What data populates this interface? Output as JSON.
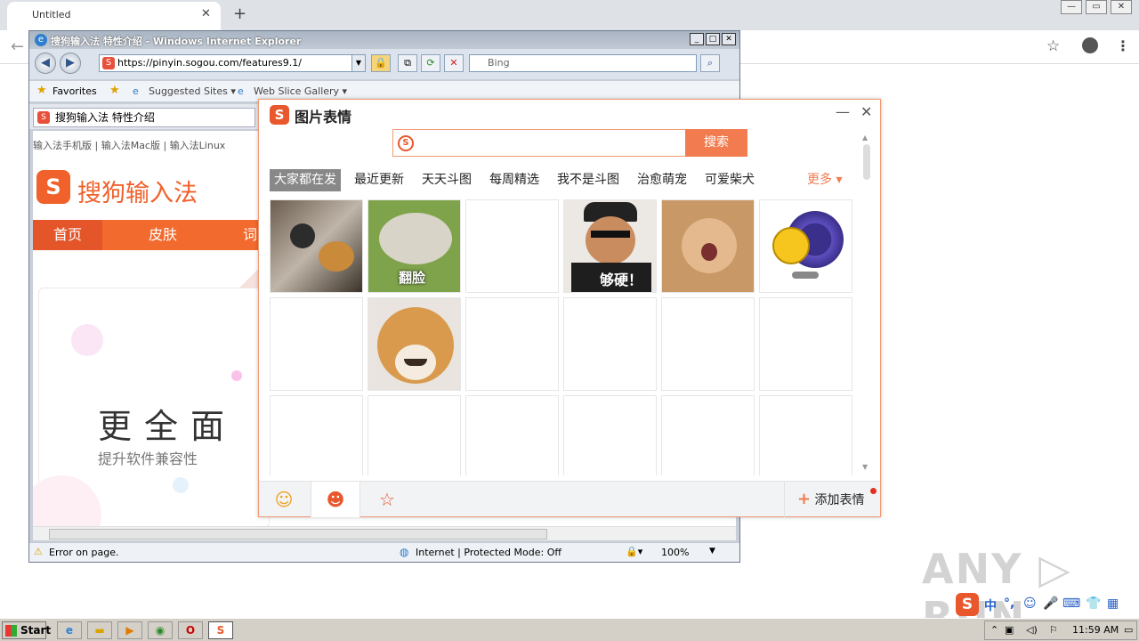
{
  "chrome": {
    "tab_title": "Untitled",
    "tab_close": "✕",
    "newtab": "+",
    "back": "←",
    "star": "☆",
    "menu": "⋮",
    "win_min": "—",
    "win_max": "▭",
    "win_close": "✕"
  },
  "ie": {
    "title": "搜狗输入法 特性介绍 - Windows Internet Explorer",
    "address": "https://pinyin.sogou.com/features9.1/",
    "search_placeholder": "Bing",
    "favorites": "Favorites",
    "suggested_sites": "Suggested Sites ▾",
    "web_slice": "Web Slice Gallery ▾",
    "tab_title": "搜狗输入法 特性介绍",
    "status_error": "Error on page.",
    "status_zone": "Internet | Protected Mode: Off",
    "status_zoom": "100%",
    "page": {
      "links": "输入法手机版   |   输入法Mac版   |   输入法Linux",
      "logo_glyph": "S",
      "site_name": "搜狗输入法",
      "nav": [
        "首页",
        "皮肤",
        "词"
      ],
      "card_title": "更全面",
      "card_sub": "提升软件兼容性"
    }
  },
  "sogou_panel": {
    "logo_glyph": "S",
    "title": "图片表情",
    "min": "—",
    "close": "✕",
    "search_icon_glyph": "S",
    "search_value": "",
    "search_button": "搜索",
    "categories": [
      "大家都在发",
      "最近更新",
      "天天斗图",
      "每周精选",
      "我不是斗图",
      "治愈萌宠",
      "可爱柴犬"
    ],
    "active_category": "大家都在发",
    "more": "更多 ▾",
    "cell_captions": {
      "fanlian": "翻脸",
      "gouying": "够硬！"
    },
    "bottom_tabs": [
      "smiley-icon",
      "sticker-icon",
      "star-icon"
    ],
    "add_label": "添加表情"
  },
  "taskbar": {
    "start": "Start",
    "clock": "11:59 AM"
  },
  "ime": {
    "items": [
      "中",
      "°,",
      "☺",
      "🎤",
      "⌨",
      "👕",
      "▦"
    ]
  },
  "watermark": "ANY ▷ RUN"
}
